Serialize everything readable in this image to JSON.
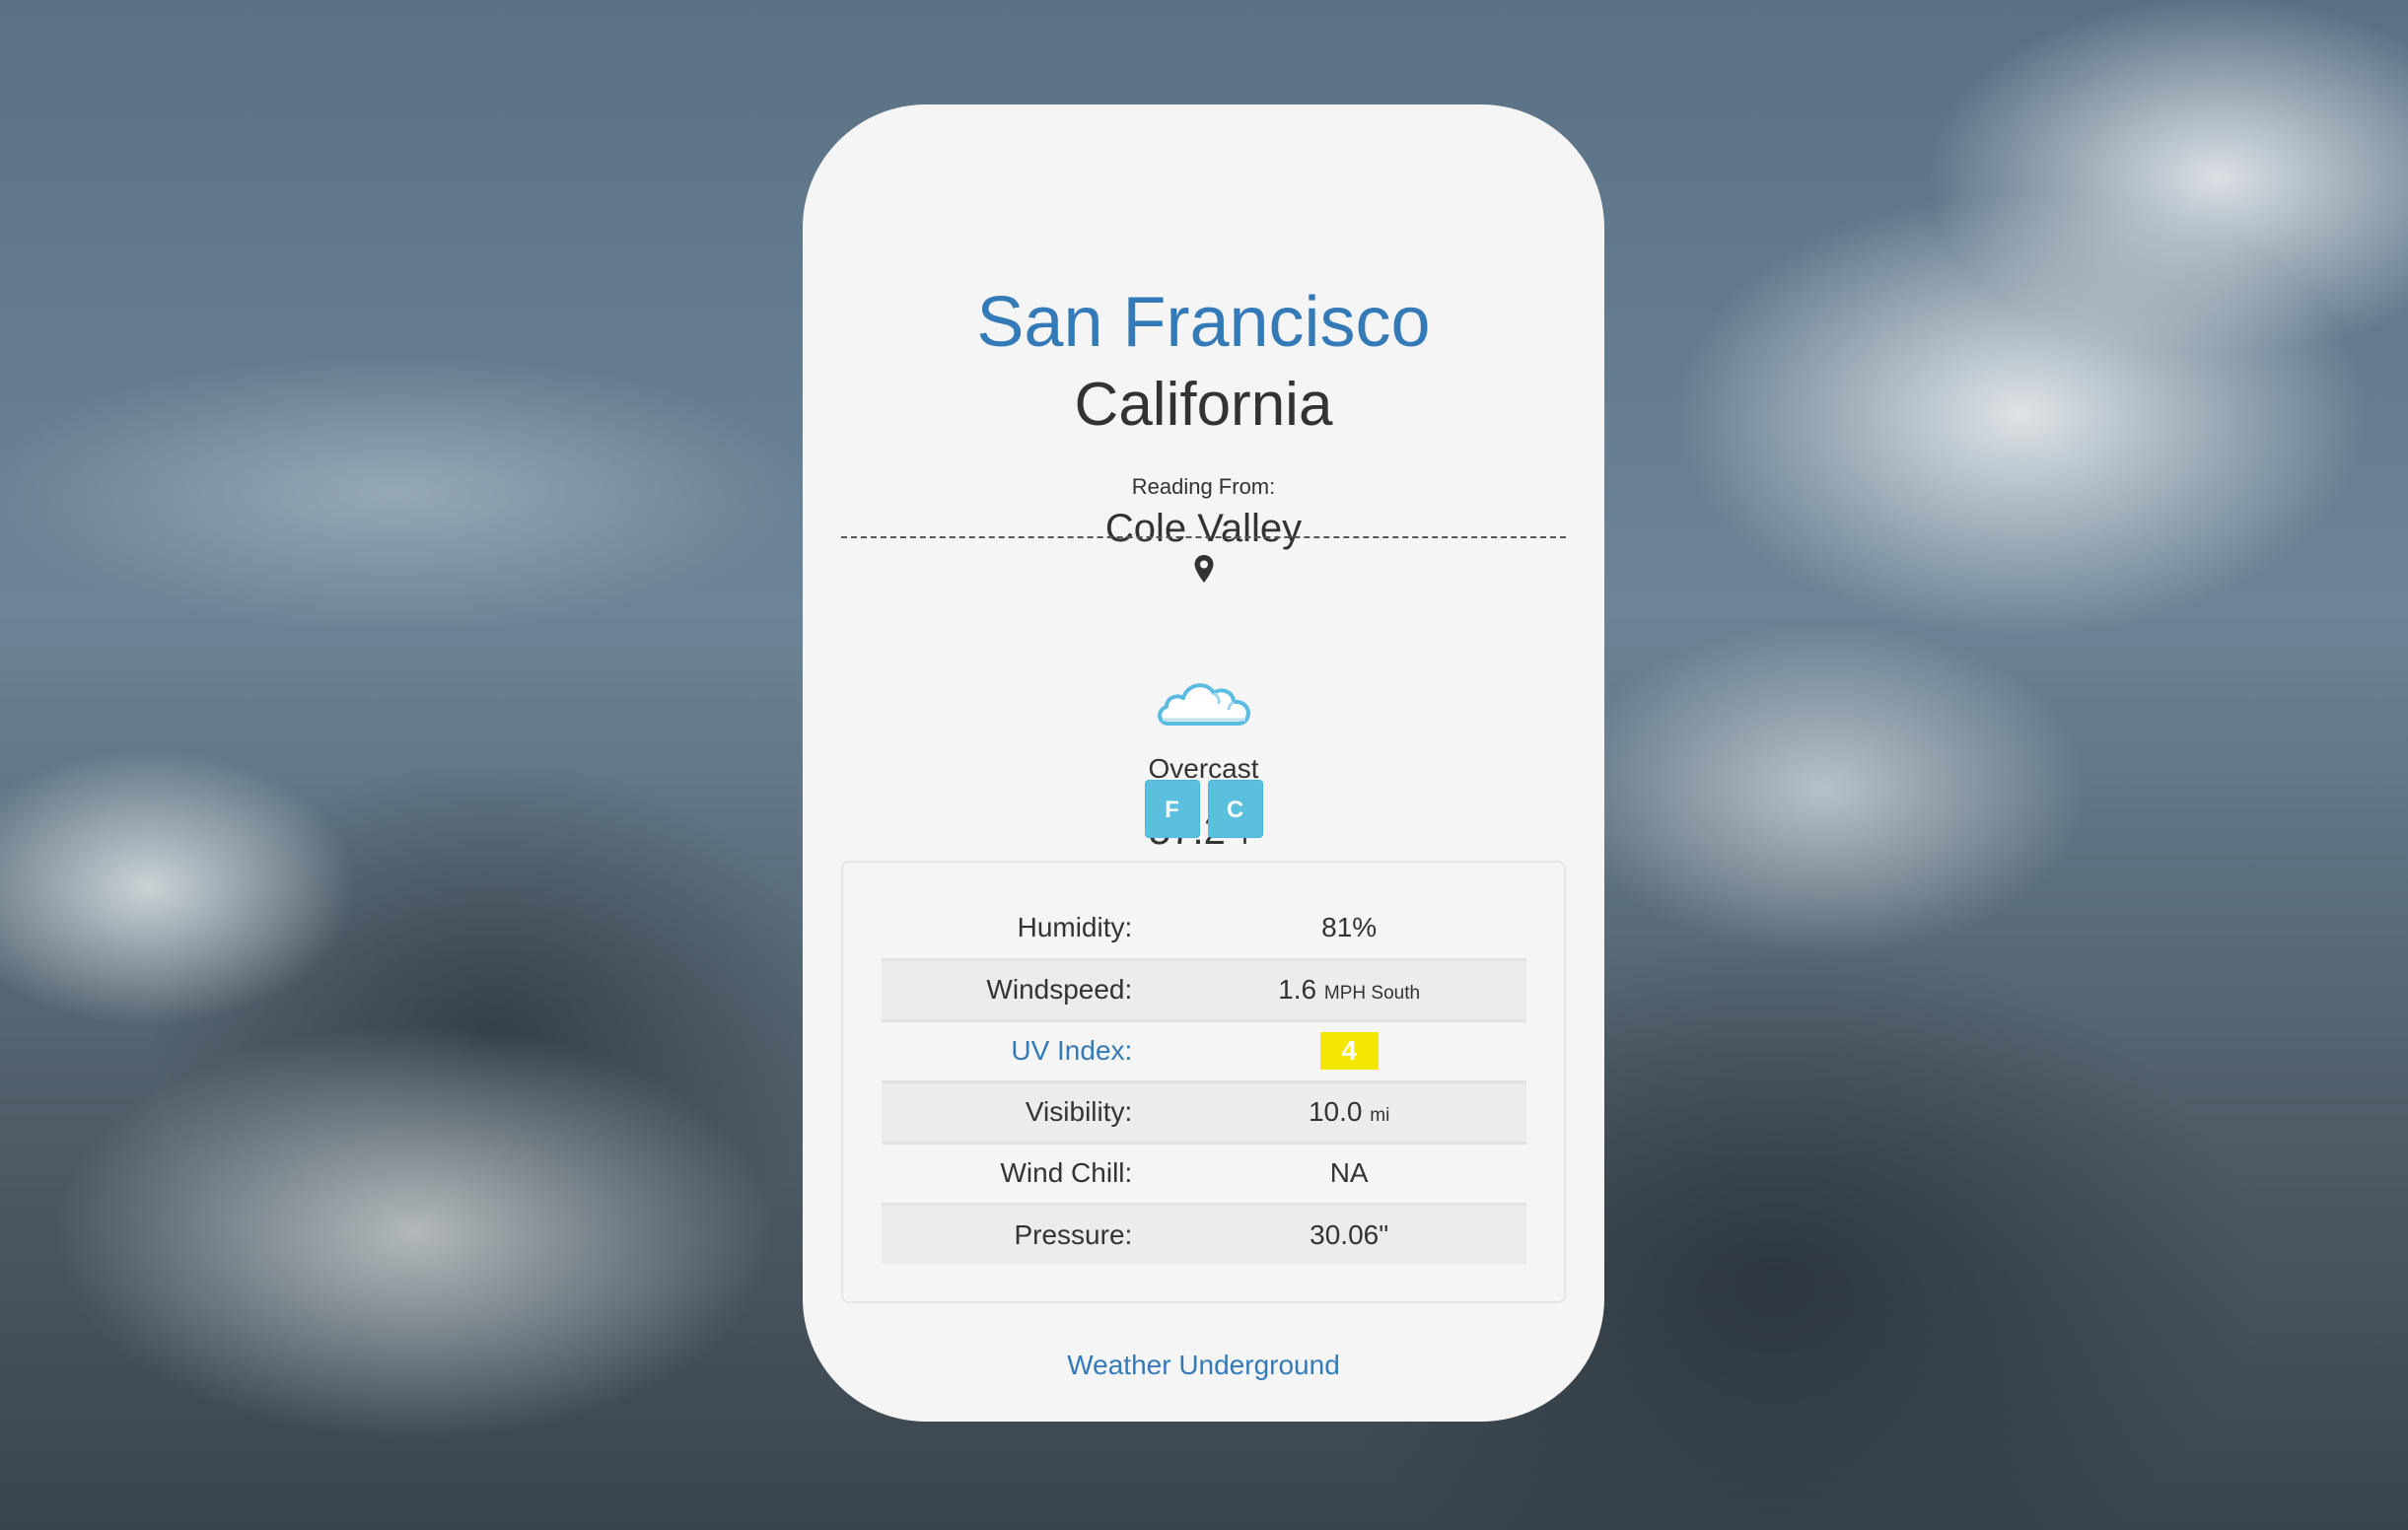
{
  "location": {
    "city": "San Francisco",
    "state": "California",
    "reading_label": "Reading From:",
    "station": "Cole Valley",
    "pin_icon": "map-marker-icon"
  },
  "current": {
    "icon": "cloud-icon",
    "condition": "Overcast",
    "temperature": "57.2",
    "degree": "°",
    "unit": "F"
  },
  "unit_buttons": {
    "f": "F",
    "c": "C"
  },
  "details": [
    {
      "label": "Humidity:",
      "value": "81%",
      "unit": ""
    },
    {
      "label": "Windspeed:",
      "value": "1.6",
      "unit": "MPH South"
    },
    {
      "label": "UV Index:",
      "value": "4",
      "unit": ""
    },
    {
      "label": "Visibility:",
      "value": "10.0",
      "unit": "mi"
    },
    {
      "label": "Wind Chill:",
      "value": "NA",
      "unit": ""
    },
    {
      "label": "Pressure:",
      "value": "30.06\"",
      "unit": ""
    }
  ],
  "footer": {
    "link": "Weather Underground"
  },
  "colors": {
    "link": "#337ab7",
    "button": "#5bc0de",
    "uv_badge": "#f5e600",
    "card": "#f5f5f5"
  }
}
